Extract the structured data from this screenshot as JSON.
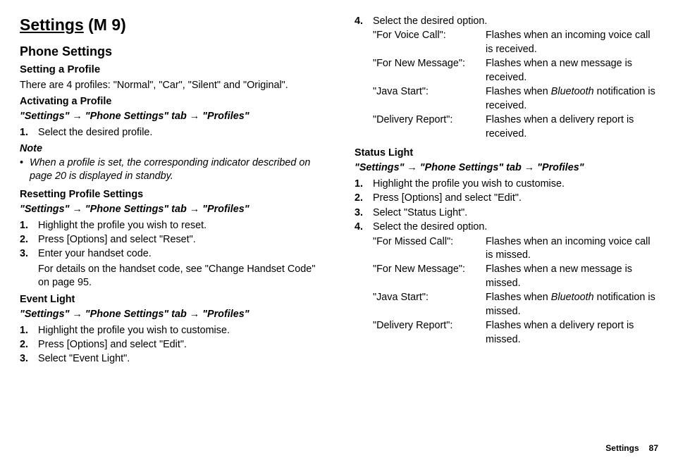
{
  "header": {
    "title": "Settings",
    "suffix": "(M 9)"
  },
  "left": {
    "h2": "Phone Settings",
    "setting_profile_h": "Setting a Profile",
    "setting_profile_body": "There are 4 profiles: \"Normal\", \"Car\", \"Silent\" and \"Original\".",
    "activating_h": "Activating a Profile",
    "nav1": "\"Settings\" → \"Phone Settings\" tab → \"Profiles\"",
    "act_step1": "Select the desired profile.",
    "note_label": "Note",
    "note_body": "When a profile is set, the corresponding indicator described on page 20 is displayed in standby.",
    "reset_h": "Resetting Profile Settings",
    "nav2": "\"Settings\" → \"Phone Settings\" tab → \"Profiles\"",
    "reset_step1": "Highlight the profile you wish to reset.",
    "reset_step2": "Press [Options] and select \"Reset\".",
    "reset_step3": "Enter your handset code.",
    "reset_sub": "For details on the handset code, see \"Change Handset Code\" on page 95.",
    "event_h": "Event Light",
    "nav3": "\"Settings\" → \"Phone Settings\" tab → \"Profiles\"",
    "ev_step1": "Highlight the profile you wish to customise.",
    "ev_step2": "Press [Options] and select \"Edit\".",
    "ev_step3": "Select \"Event Light\"."
  },
  "right": {
    "ev_step4": "Select the desired option.",
    "ev_opts": [
      {
        "k": "\"For Voice Call\":",
        "v_pre": "Flashes when an incoming voice call is received.",
        "bt": false
      },
      {
        "k": "\"For New Message\":",
        "v_pre": "Flashes when a new message is received.",
        "bt": false
      },
      {
        "k": "\"Java Start\":",
        "v_pre": "Flashes when ",
        "bt": true,
        "v_post": " notification is received."
      },
      {
        "k": "\"Delivery Report\":",
        "v_pre": "Flashes when a delivery report is received.",
        "bt": false
      }
    ],
    "status_h": "Status Light",
    "nav4": "\"Settings\" → \"Phone Settings\" tab → \"Profiles\"",
    "sl_step1": "Highlight the profile you wish to customise.",
    "sl_step2": "Press [Options] and select \"Edit\".",
    "sl_step3": "Select \"Status Light\".",
    "sl_step4": "Select the desired option.",
    "sl_opts": [
      {
        "k": "\"For Missed Call\":",
        "v_pre": "Flashes when an incoming voice call is missed.",
        "bt": false
      },
      {
        "k": "\"For New Message\":",
        "v_pre": "Flashes when a new message is missed.",
        "bt": false
      },
      {
        "k": "\"Java Start\":",
        "v_pre": "Flashes when ",
        "bt": true,
        "v_post": " notification is missed."
      },
      {
        "k": "\"Delivery Report\":",
        "v_pre": "Flashes when a delivery report is missed.",
        "bt": false
      }
    ]
  },
  "bt_word": "Bluetooth",
  "footer": {
    "section": "Settings",
    "page": "87"
  }
}
